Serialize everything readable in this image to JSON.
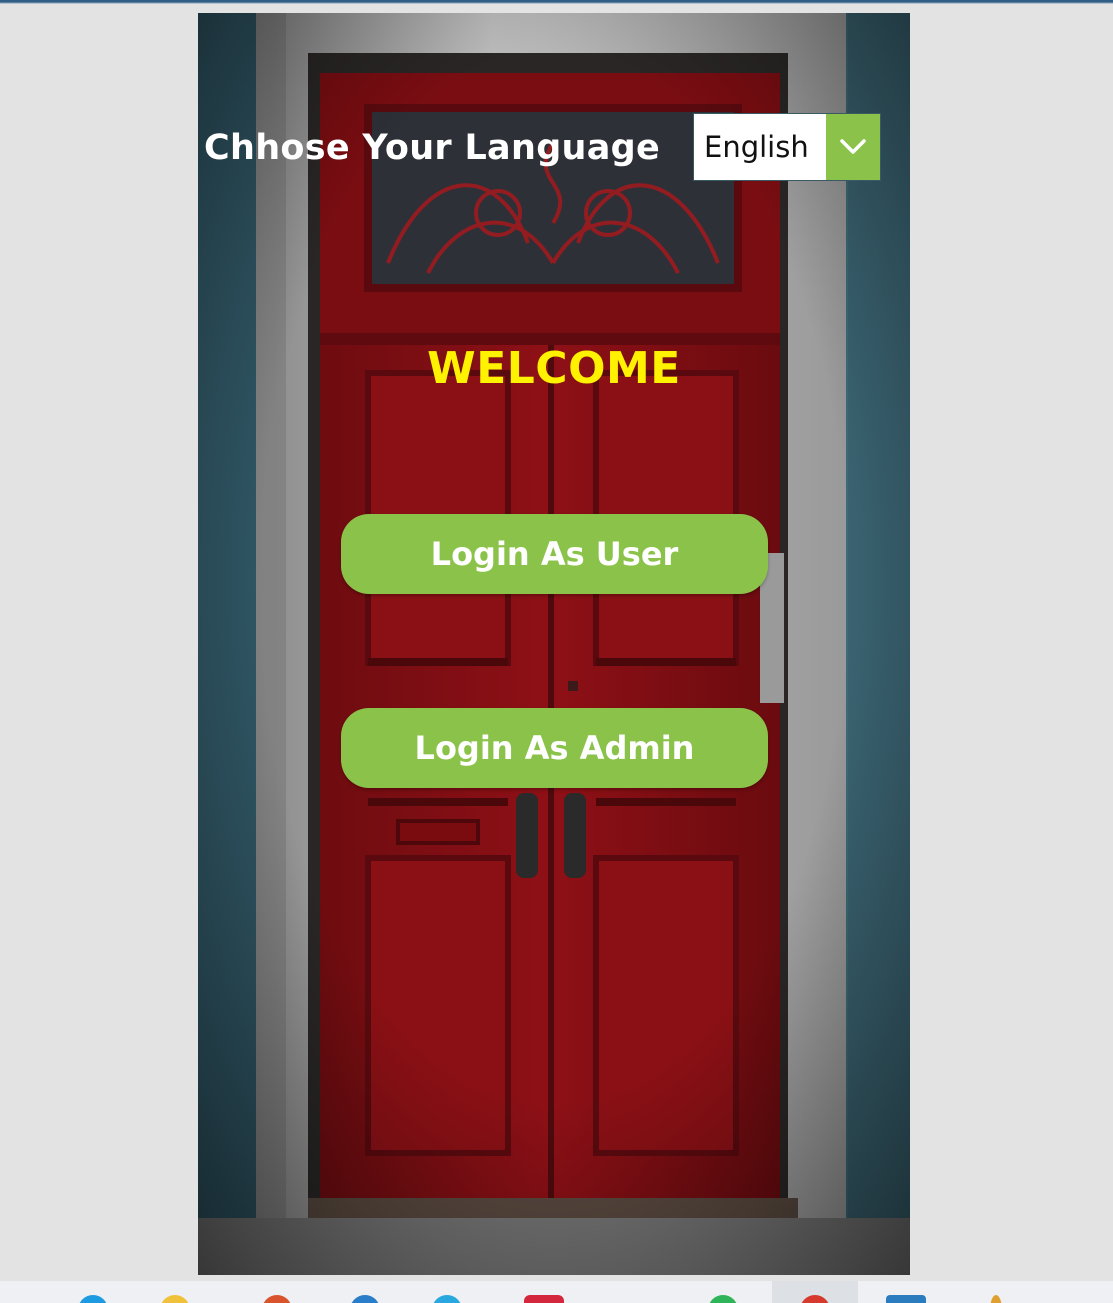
{
  "language": {
    "label": "Chhose Your Language",
    "selected": "English"
  },
  "welcome": "WELCOME",
  "buttons": {
    "user": "Login As User",
    "admin": "Login As Admin"
  },
  "colors": {
    "accent_green": "#8bc34a",
    "welcome_yellow": "#fff200",
    "door_red": "#8e1016"
  },
  "icons": {
    "dropdown": "chevron-down-icon"
  }
}
